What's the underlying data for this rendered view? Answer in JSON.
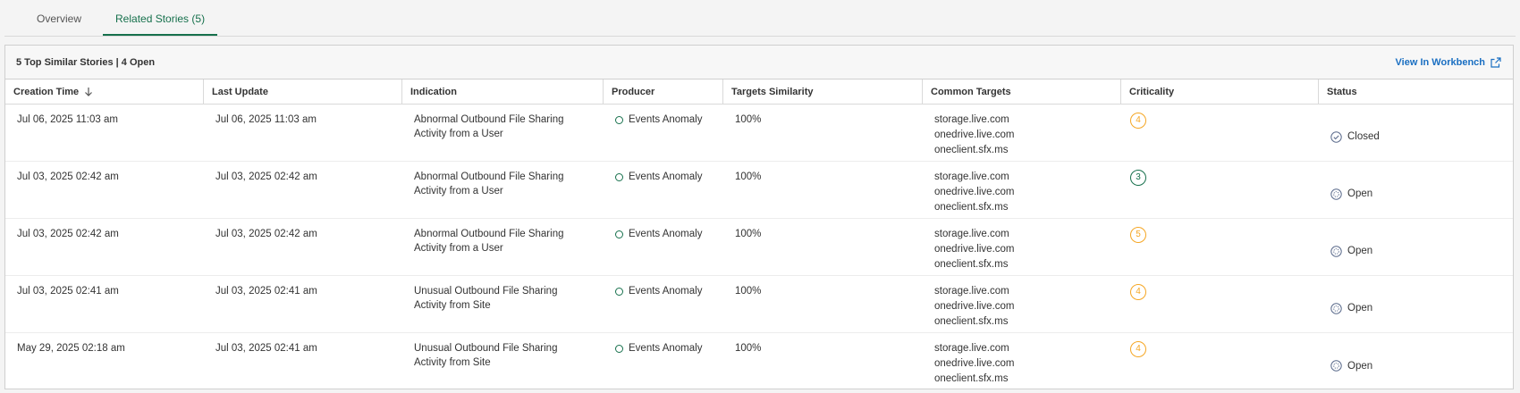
{
  "tabs": [
    {
      "label": "Overview",
      "active": false
    },
    {
      "label": "Related Stories (5)",
      "active": true
    }
  ],
  "panel": {
    "summary": "5 Top Similar Stories | 4 Open",
    "link_label": "View In Workbench",
    "link_icon": "external-link-icon",
    "link_color": "#1a6fc2"
  },
  "table": {
    "columns": [
      "Creation Time",
      "Last Update",
      "Indication",
      "Producer",
      "Targets Similarity",
      "Common Targets",
      "Criticality",
      "Status"
    ],
    "sort_icon": "arrow-down-icon",
    "rows": [
      {
        "creation": "Jul 06, 2025 11:03 am",
        "update": "Jul 06, 2025 11:03 am",
        "indication": "Abnormal Outbound File Sharing Activity from a User",
        "producer": "Events Anomaly",
        "similarity": "100%",
        "targets": [
          "storage.live.com",
          "onedrive.live.com",
          "oneclient.sfx.ms"
        ],
        "criticality": "4",
        "crit_color": "#f5a623",
        "status": "Closed",
        "status_icon": "check-circle-icon"
      },
      {
        "creation": "Jul 03, 2025 02:42 am",
        "update": "Jul 03, 2025 02:42 am",
        "indication": "Abnormal Outbound File Sharing Activity from a User",
        "producer": "Events Anomaly",
        "similarity": "100%",
        "targets": [
          "storage.live.com",
          "onedrive.live.com",
          "oneclient.sfx.ms"
        ],
        "criticality": "3",
        "crit_color": "#16704c",
        "status": "Open",
        "status_icon": "open-status-icon"
      },
      {
        "creation": "Jul 03, 2025 02:42 am",
        "update": "Jul 03, 2025 02:42 am",
        "indication": "Abnormal Outbound File Sharing Activity from a User",
        "producer": "Events Anomaly",
        "similarity": "100%",
        "targets": [
          "storage.live.com",
          "onedrive.live.com",
          "oneclient.sfx.ms"
        ],
        "criticality": "5",
        "crit_color": "#f5a623",
        "status": "Open",
        "status_icon": "open-status-icon"
      },
      {
        "creation": "Jul 03, 2025 02:41 am",
        "update": "Jul 03, 2025 02:41 am",
        "indication": "Unusual Outbound File Sharing Activity from Site",
        "producer": "Events Anomaly",
        "similarity": "100%",
        "targets": [
          "storage.live.com",
          "onedrive.live.com",
          "oneclient.sfx.ms"
        ],
        "criticality": "4",
        "crit_color": "#f5a623",
        "status": "Open",
        "status_icon": "open-status-icon"
      },
      {
        "creation": "May 29, 2025 02:18 am",
        "update": "Jul 03, 2025 02:41 am",
        "indication": "Unusual Outbound File Sharing Activity from Site",
        "producer": "Events Anomaly",
        "similarity": "100%",
        "targets": [
          "storage.live.com",
          "onedrive.live.com",
          "oneclient.sfx.ms"
        ],
        "criticality": "4",
        "crit_color": "#f5a623",
        "status": "Open",
        "status_icon": "open-status-icon"
      }
    ]
  },
  "colors": {
    "accent": "#16704c",
    "status_icon": "#5b6b8c"
  }
}
